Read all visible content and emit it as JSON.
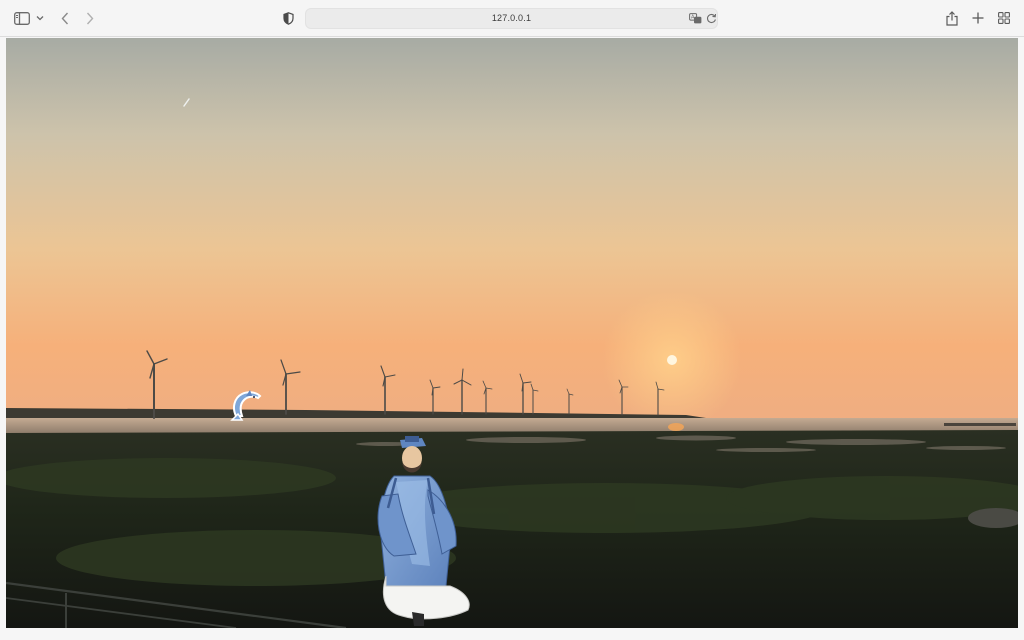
{
  "browser": {
    "url": "127.0.0.1",
    "icons": {
      "sidebar": "sidebar-toggle-icon",
      "sidebar_menu": "chevron-down-icon",
      "back": "chevron-left-icon",
      "forward": "chevron-right-icon",
      "privacy": "shield-icon",
      "translate": "translate-icon",
      "reload": "reload-icon",
      "share": "share-icon",
      "new_tab": "plus-icon",
      "tab_overview": "grid-icon"
    }
  },
  "scene": {
    "sky_top": "#a8aaa2",
    "sky_mid": "#dcc7a5",
    "sky_horizon": "#f3b27c",
    "sun": "#fff4d8",
    "ground": "#1d2118",
    "sprites": [
      "dolphin",
      "sage-figure"
    ]
  }
}
